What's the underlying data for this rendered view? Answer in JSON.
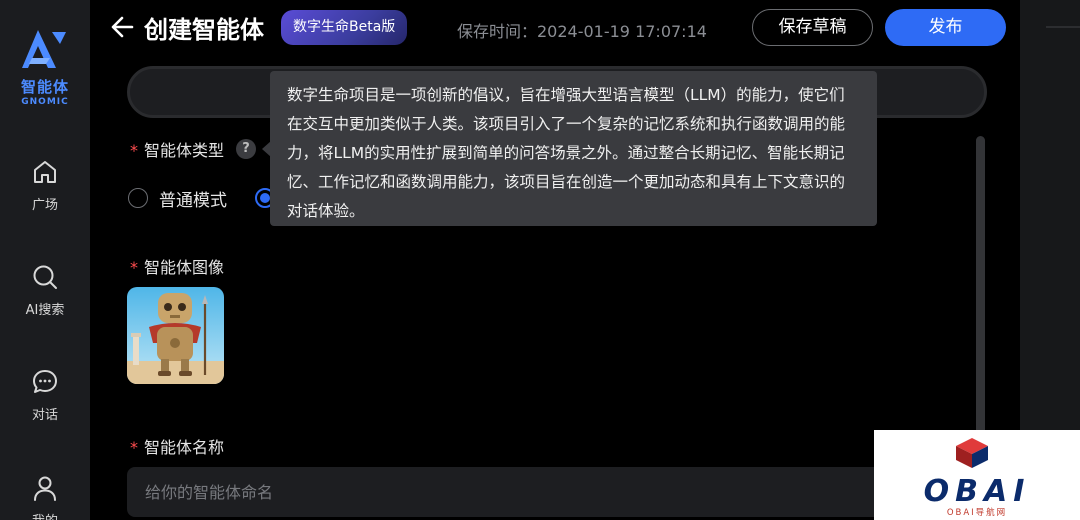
{
  "sidebar": {
    "logo_cn": "智能体",
    "logo_en": "GNOMIC",
    "items": [
      {
        "label": "广场",
        "icon": "home-icon"
      },
      {
        "label": "AI搜索",
        "icon": "search-icon"
      },
      {
        "label": "对话",
        "icon": "chat-icon"
      },
      {
        "label": "我的",
        "icon": "user-icon"
      }
    ]
  },
  "header": {
    "title": "创建智能体",
    "badge": "数字生命Beta版",
    "save_time": "保存时间：2024-01-19 17:07:14",
    "draft_label": "保存草稿",
    "publish_label": "发布"
  },
  "form": {
    "type_label": "智能体类型",
    "help_glyph": "?",
    "modes": [
      {
        "label": "普通模式",
        "selected": false
      },
      {
        "label": "",
        "selected": true
      }
    ],
    "image_label": "智能体图像",
    "name_label": "智能体名称",
    "name_placeholder": "给你的智能体命名",
    "name_value": ""
  },
  "tooltip": {
    "text": "数字生命项目是一项创新的倡议，旨在增强大型语言模型（LLM）的能力，使它们在交互中更加类似于人类。该项目引入了一个复杂的记忆系统和执行函数调用的能力，将LLM的实用性扩展到简单的问答场景之外。通过整合长期记忆、智能长期记忆、工作记忆和函数调用能力，该项目旨在创造一个更加动态和具有上下文意识的对话体验。"
  },
  "watermark": {
    "text": "OBAI",
    "sub": "OBAI导航网"
  },
  "colors": {
    "accent": "#2e6bf5",
    "required": "#ff4d4f",
    "tooltip_bg": "#3a3b3f",
    "sidebar_bg": "#1b1c1f"
  }
}
